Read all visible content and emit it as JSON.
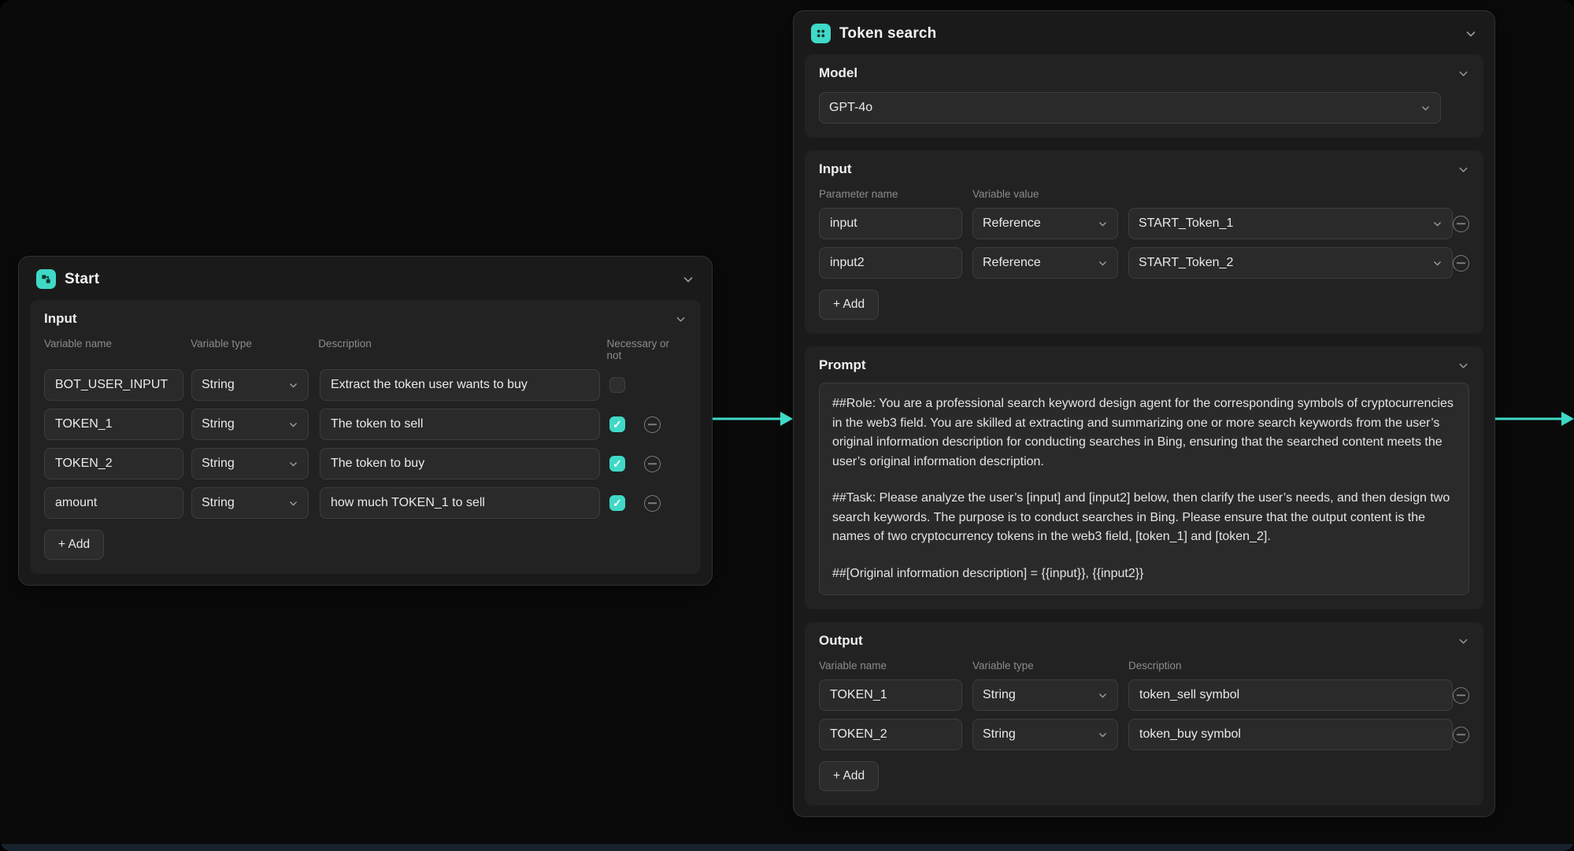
{
  "accent": "#3fd9c6",
  "start_node": {
    "title": "Start",
    "input": {
      "title": "Input",
      "columns": {
        "name": "Variable name",
        "type": "Variable type",
        "desc": "Description",
        "necessary": "Necessary or not"
      },
      "rows": [
        {
          "name": "BOT_USER_INPUT",
          "type": "String",
          "desc": "Extract the token user wants to buy",
          "necessary": false
        },
        {
          "name": "TOKEN_1",
          "type": "String",
          "desc": "The token to sell",
          "necessary": true
        },
        {
          "name": "TOKEN_2",
          "type": "String",
          "desc": "The token to buy",
          "necessary": true
        },
        {
          "name": "amount",
          "type": "String",
          "desc": "how much TOKEN_1 to sell",
          "necessary": true
        }
      ],
      "add_label": "+ Add"
    }
  },
  "token_node": {
    "title": "Token search",
    "model": {
      "title": "Model",
      "selected": "GPT-4o"
    },
    "input": {
      "title": "Input",
      "columns": {
        "param": "Parameter name",
        "value": "Variable value"
      },
      "rows": [
        {
          "param": "input",
          "mode": "Reference",
          "value": "START_Token_1"
        },
        {
          "param": "input2",
          "mode": "Reference",
          "value": "START_Token_2"
        }
      ],
      "add_label": "+ Add"
    },
    "prompt": {
      "title": "Prompt",
      "paragraphs": [
        "##Role: You are a professional search keyword design agent for the corresponding symbols of cryptocurrencies in the web3 field. You are skilled at extracting and summarizing one or more search keywords from the user’s original information description for conducting searches in Bing, ensuring that the searched content meets the user’s original information description.",
        "##Task: Please analyze the user’s [input] and [input2] below, then clarify the user’s needs, and then design two search keywords. The purpose is to conduct searches in Bing. Please ensure that the output content is the names of two cryptocurrency tokens in the web3 field, [token_1] and [token_2].",
        "##[Original information description] = {{input}}, {{input2}}"
      ]
    },
    "output": {
      "title": "Output",
      "columns": {
        "name": "Variable name",
        "type": "Variable type",
        "desc": "Description"
      },
      "rows": [
        {
          "name": "TOKEN_1",
          "type": "String",
          "desc": "token_sell symbol"
        },
        {
          "name": "TOKEN_2",
          "type": "String",
          "desc": "token_buy symbol"
        }
      ],
      "add_label": "+ Add"
    }
  }
}
